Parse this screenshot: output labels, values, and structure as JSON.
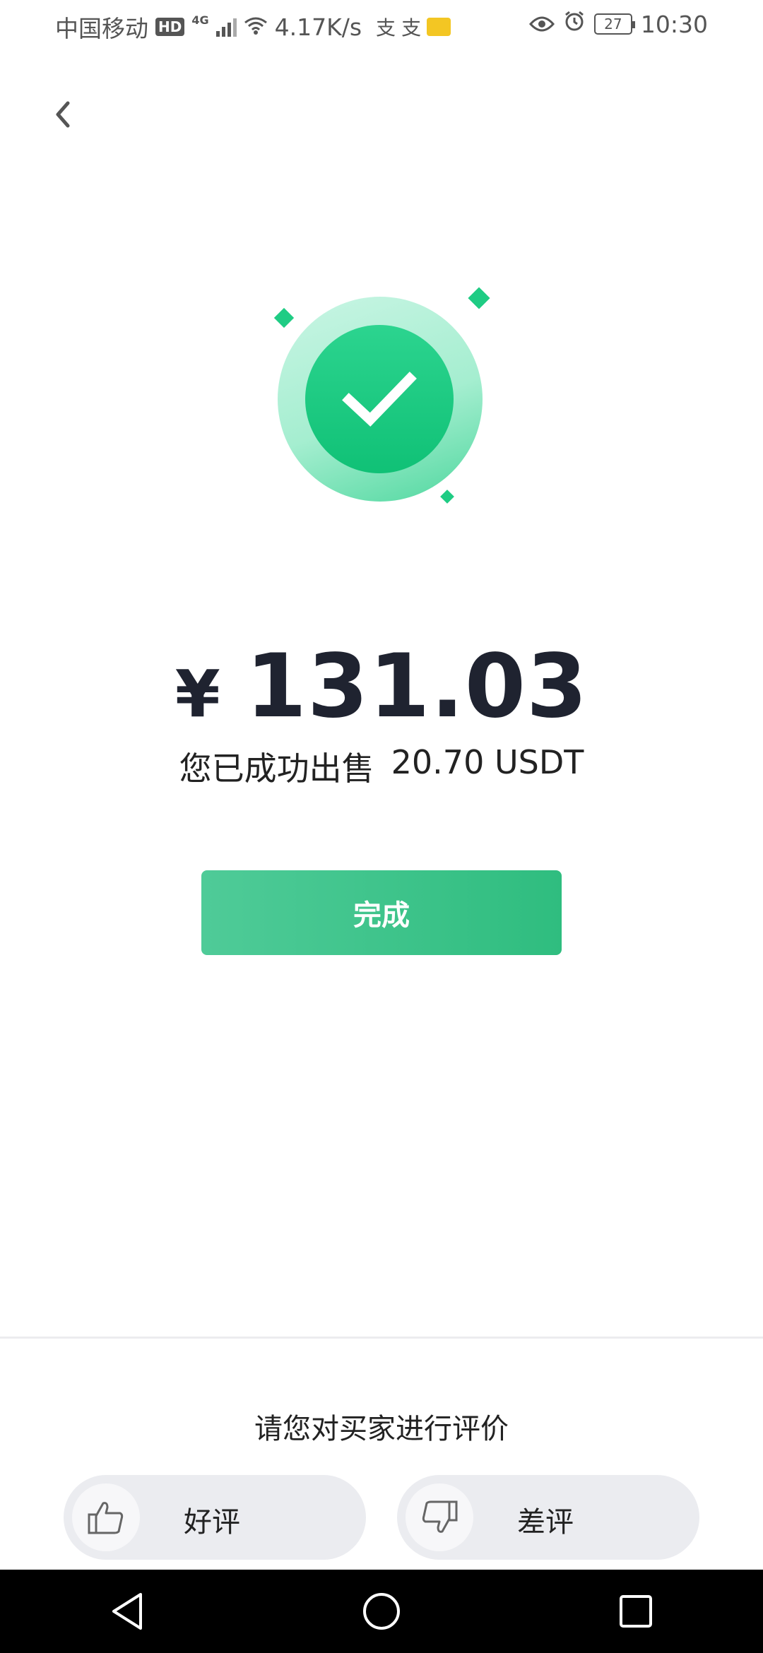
{
  "status_bar": {
    "carrier": "中国移动",
    "hd_badge": "HD",
    "network_type": "4G",
    "speed": "4.17K/s",
    "battery": "27",
    "time": "10:30"
  },
  "success": {
    "currency": "¥",
    "amount": "131.03",
    "sold_label": "您已成功出售",
    "sold_amount": "20.70 USDT"
  },
  "done_button_label": "完成",
  "rating": {
    "prompt": "请您对买家进行评价",
    "good_label": "好评",
    "bad_label": "差评"
  },
  "colors": {
    "accent": "#2fbd7f",
    "success_green": "#10c176",
    "nav_bar": "#000000"
  },
  "icons": [
    "back-arrow-icon",
    "check-icon",
    "thumbs-up-icon",
    "thumbs-down-icon",
    "nav-back-icon",
    "nav-home-icon",
    "nav-recents-icon"
  ]
}
